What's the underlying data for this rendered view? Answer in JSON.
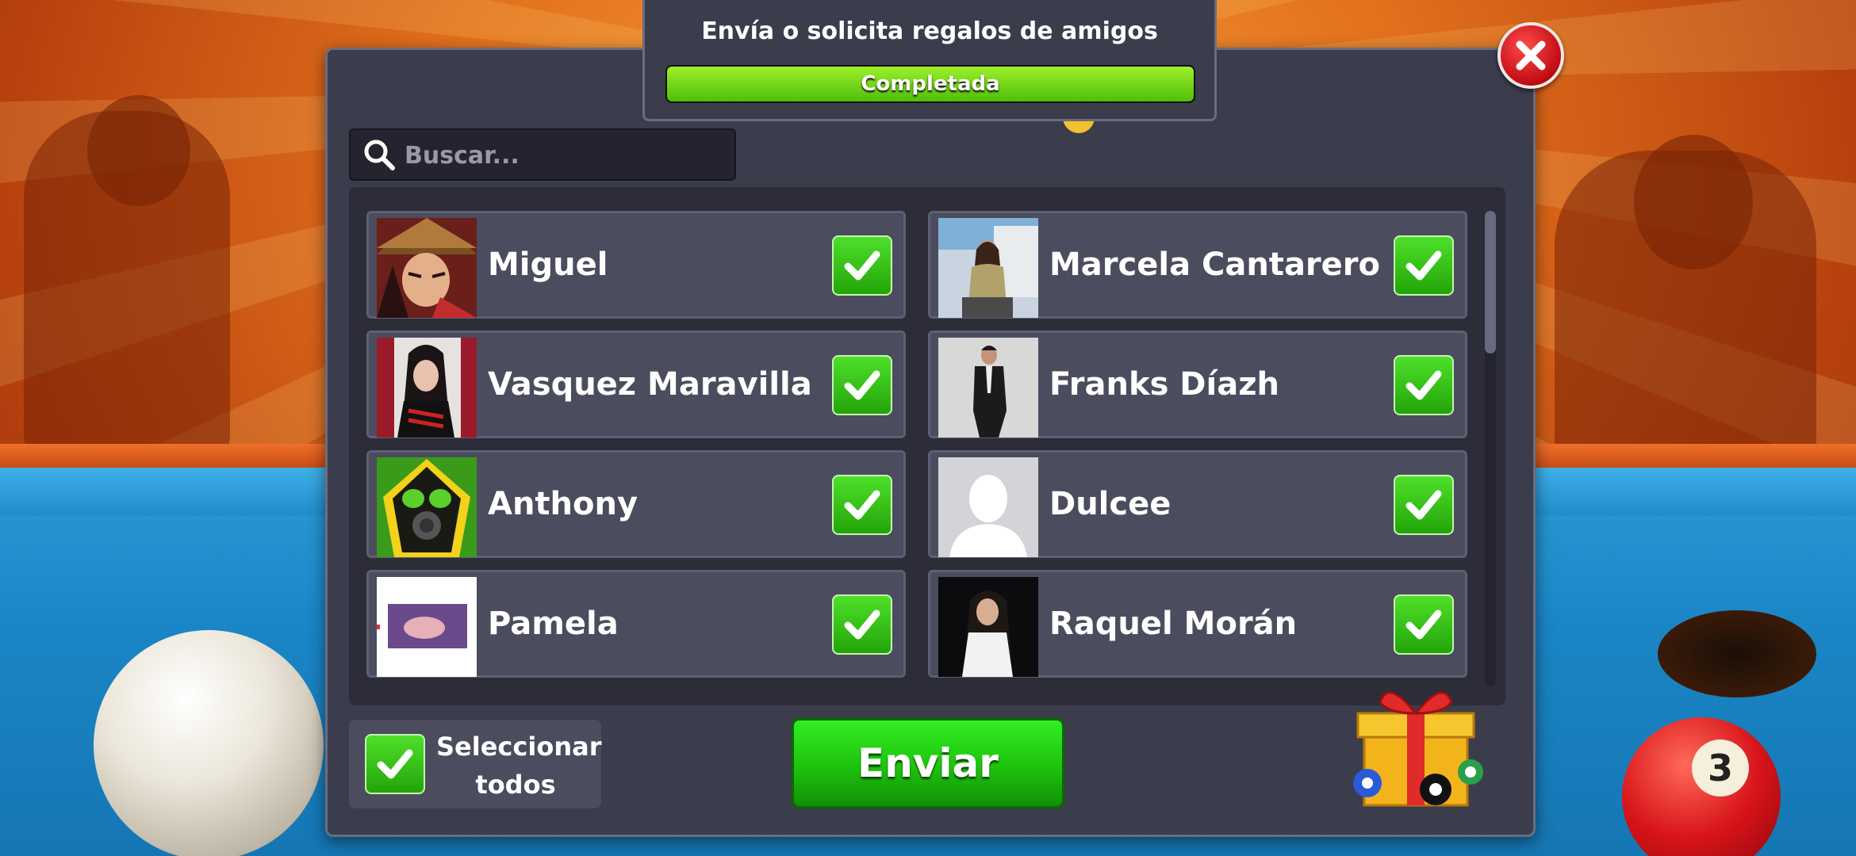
{
  "mission": {
    "title": "Envía o solicita regalos de amigos",
    "status": "Completada",
    "progress": 1.0
  },
  "search": {
    "placeholder": "Buscar..."
  },
  "friends": [
    {
      "name": "Miguel",
      "selected": true
    },
    {
      "name": "Marcela Cantarero",
      "selected": true
    },
    {
      "name": "Vasquez Maravilla",
      "selected": true
    },
    {
      "name": "Franks Díazh",
      "selected": true
    },
    {
      "name": "Anthony",
      "selected": true
    },
    {
      "name": "Dulcee",
      "selected": true
    },
    {
      "name": "Pamela",
      "selected": true
    },
    {
      "name": "Raquel Morán",
      "selected": true
    }
  ],
  "select_all": {
    "label_line1": "Seleccionar",
    "label_line2": "todos",
    "checked": true
  },
  "send_button": {
    "label": "Enviar"
  },
  "ball_number": "3",
  "colors": {
    "accent_green": "#23a40a",
    "close_red": "#c00c12",
    "panel": "#3b3d4c"
  }
}
